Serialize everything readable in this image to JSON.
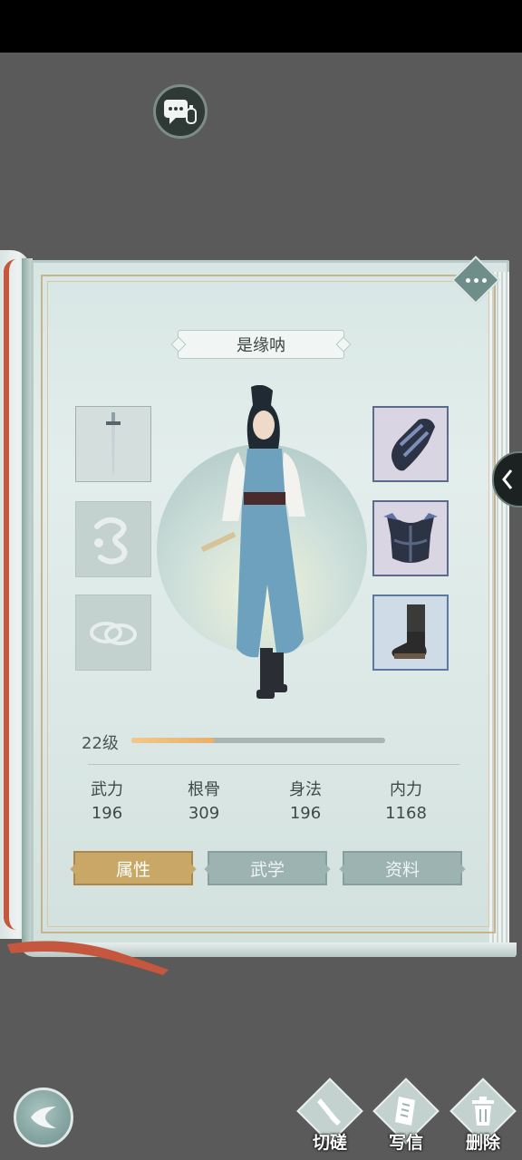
{
  "character": {
    "name": "是缘呐",
    "level_label": "22级",
    "level_progress": 0.33
  },
  "stats": [
    {
      "label": "武力",
      "value": "196"
    },
    {
      "label": "根骨",
      "value": "309"
    },
    {
      "label": "身法",
      "value": "196"
    },
    {
      "label": "内力",
      "value": "1168"
    }
  ],
  "tabs": [
    {
      "label": "属性",
      "active": true
    },
    {
      "label": "武学",
      "active": false
    },
    {
      "label": "资料",
      "active": false
    }
  ],
  "equipment": {
    "left": [
      "sword-icon",
      "empty-accessory-icon",
      "empty-ring-icon"
    ],
    "right": [
      "bracer-icon",
      "armor-icon",
      "boot-icon"
    ]
  },
  "actions": [
    {
      "label": "切磋",
      "icon": "sword-duel-icon"
    },
    {
      "label": "写信",
      "icon": "letter-icon"
    },
    {
      "label": "删除",
      "icon": "trash-icon"
    }
  ],
  "colors": {
    "accent_gold": "#c9a867",
    "tab_inactive": "#9cb3b1",
    "level_fill": "#f2c88a",
    "page_bg": "#dae7e5",
    "ribbon": "#c4573d"
  }
}
